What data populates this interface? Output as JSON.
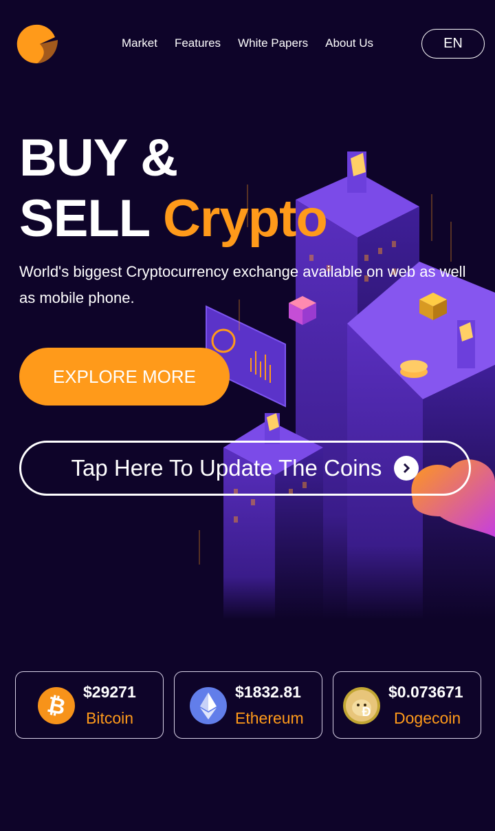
{
  "nav": {
    "items": [
      "Market",
      "Features",
      "White Papers",
      "About Us"
    ],
    "lang": "EN"
  },
  "hero": {
    "title_line1": "BUY &",
    "title_line2_white": "SELL",
    "title_line2_accent": "Crypto",
    "subtitle": "World's biggest Cryptocurrency exchange available on web as well as mobile phone.",
    "explore_label": "EXPLORE MORE",
    "update_label": "Tap Here To Update The Coins"
  },
  "coins": [
    {
      "price": "$29271",
      "name": "Bitcoin",
      "icon": "bitcoin-icon"
    },
    {
      "price": "$1832.81",
      "name": "Ethereum",
      "icon": "ethereum-icon"
    },
    {
      "price": "$0.073671",
      "name": "Dogecoin",
      "icon": "dogecoin-icon"
    }
  ],
  "colors": {
    "background": "#0e0429",
    "accent": "#ff9a1a",
    "building": "#6a3bd9",
    "bitcoin": "#f7931a",
    "ethereum": "#627eea"
  }
}
